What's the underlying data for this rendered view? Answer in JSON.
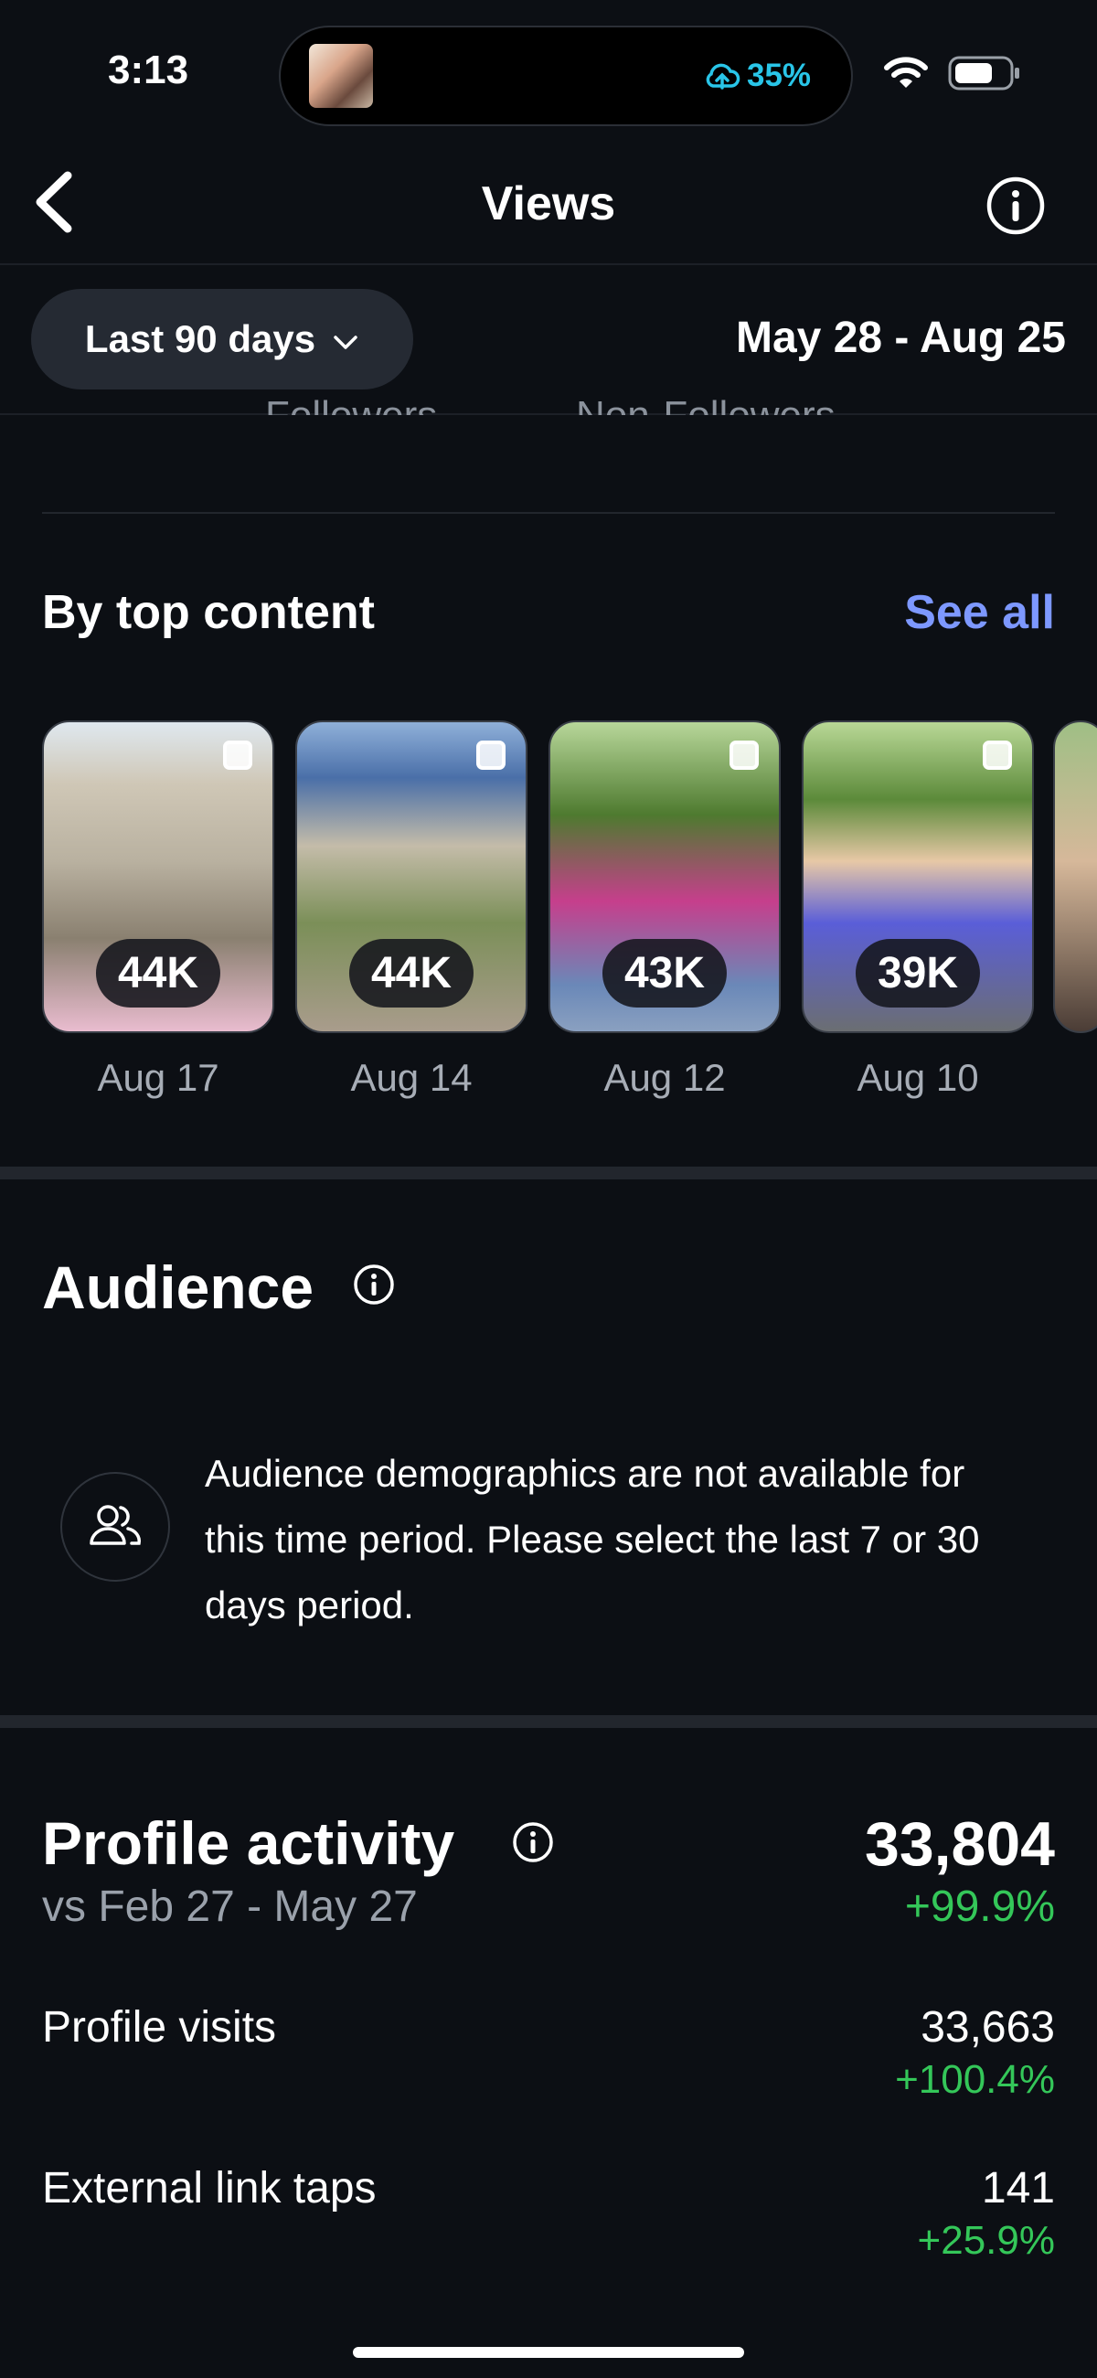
{
  "status_bar": {
    "time": "3:13",
    "battery_text": "35%",
    "cloud_icon": "cloud-upload-icon",
    "wifi_icon": "wifi-icon",
    "battery_icon": "battery-icon"
  },
  "header": {
    "title": "Views",
    "back_icon": "chevron-left-icon",
    "info_icon": "info-icon"
  },
  "filter": {
    "range_label": "Last 90 days",
    "date_range": "May 28 - Aug 25"
  },
  "partial_labels": {
    "left": "Followers",
    "right": "Non-Followers"
  },
  "top_content": {
    "title": "By top content",
    "see_all": "See all",
    "items": [
      {
        "views": "44K",
        "date": "Aug 17"
      },
      {
        "views": "44K",
        "date": "Aug 14"
      },
      {
        "views": "43K",
        "date": "Aug 12"
      },
      {
        "views": "39K",
        "date": "Aug 10"
      }
    ]
  },
  "audience": {
    "title": "Audience",
    "message": "Audience demographics are not available for this time period. Please select the last 7 or 30 days period."
  },
  "profile_activity": {
    "title": "Profile activity",
    "total": "33,804",
    "comparison": "vs Feb 27 - May 27",
    "change": "+99.9%",
    "rows": [
      {
        "label": "Profile visits",
        "value": "33,663",
        "change": "+100.4%"
      },
      {
        "label": "External link taps",
        "value": "141",
        "change": "+25.9%"
      }
    ]
  },
  "colors": {
    "background": "#0c0f14",
    "accent_link": "#7d98ff",
    "positive": "#34c759",
    "battery_status": "#29c5e8"
  }
}
